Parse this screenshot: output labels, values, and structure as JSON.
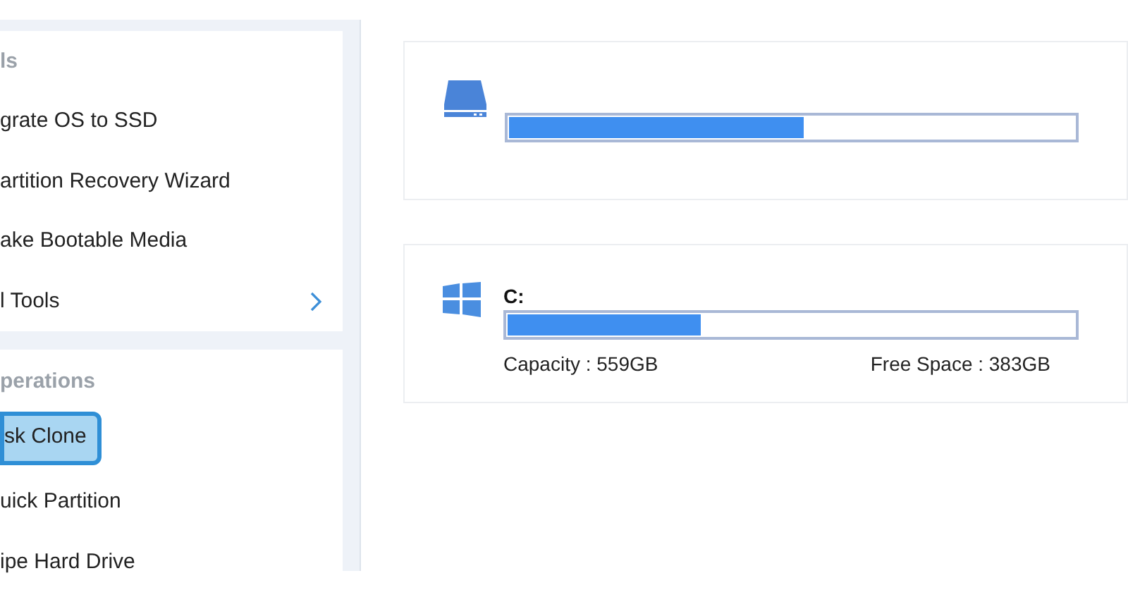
{
  "sidebar": {
    "sections": [
      {
        "title": "ls",
        "items": [
          {
            "label": "grate OS to SSD",
            "selected": false,
            "expandable": false
          },
          {
            "label": "artition Recovery Wizard",
            "selected": false,
            "expandable": false
          },
          {
            "label": "ake Bootable Media",
            "selected": false,
            "expandable": false
          },
          {
            "label": "l Tools",
            "selected": false,
            "expandable": true
          }
        ]
      },
      {
        "title": "perations",
        "items": [
          {
            "label": "sk Clone",
            "selected": true,
            "expandable": false
          },
          {
            "label": "uick Partition",
            "selected": false,
            "expandable": false
          },
          {
            "label": "ipe Hard Drive",
            "selected": false,
            "expandable": false
          }
        ]
      }
    ]
  },
  "disks": [
    {
      "kind": "disk",
      "level": 0.52
    },
    {
      "kind": "windows",
      "name": "C:",
      "level": 0.34,
      "capacity": "Capacity : 559GB",
      "free_space": "Free Space : 383GB"
    }
  ]
}
